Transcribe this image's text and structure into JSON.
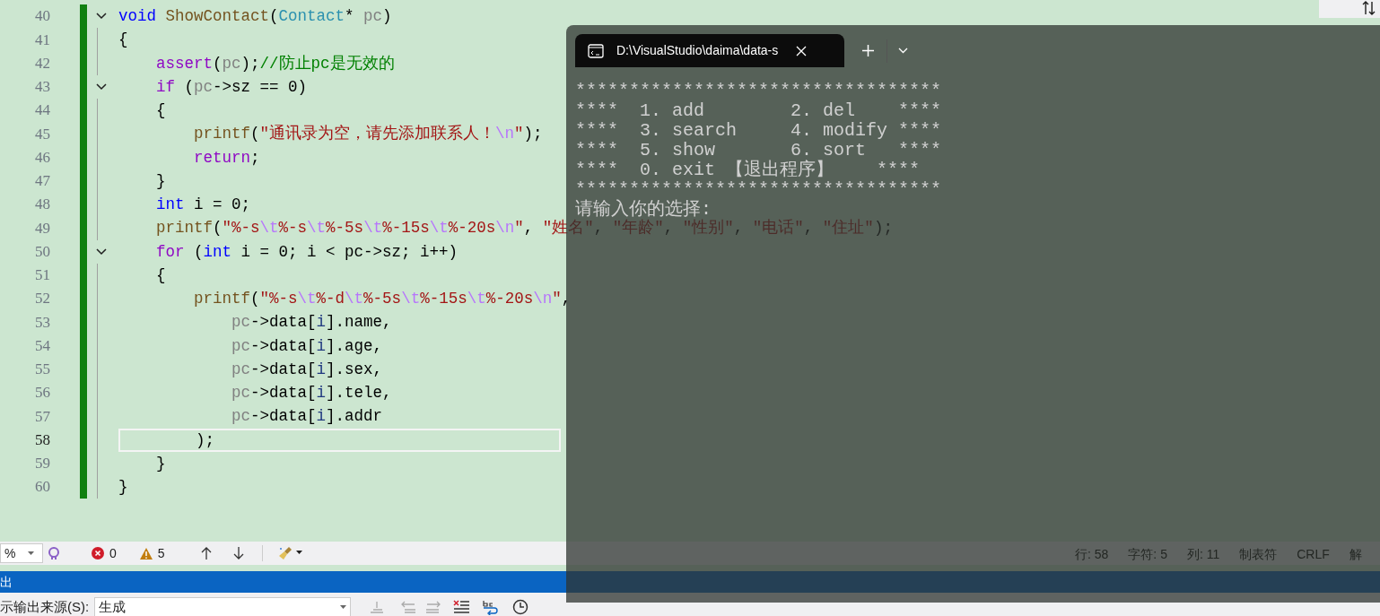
{
  "editor": {
    "lines": [
      {
        "number": "40",
        "foldable": true,
        "current": false,
        "tokens": [
          {
            "kind": "keyword",
            "text": "void "
          },
          {
            "kind": "function",
            "text": "ShowContact"
          },
          {
            "kind": "plain",
            "text": "("
          },
          {
            "kind": "type",
            "text": "Contact"
          },
          {
            "kind": "plain",
            "text": "* "
          },
          {
            "kind": "param",
            "text": "pc"
          },
          {
            "kind": "plain",
            "text": ")"
          }
        ]
      },
      {
        "number": "41",
        "foldable": false,
        "current": false,
        "tokens": [
          {
            "kind": "plain",
            "text": "{"
          }
        ]
      },
      {
        "number": "42",
        "foldable": false,
        "current": false,
        "tokens": [
          {
            "kind": "control",
            "text": "    assert"
          },
          {
            "kind": "plain",
            "text": "("
          },
          {
            "kind": "param",
            "text": "pc"
          },
          {
            "kind": "plain",
            "text": ");"
          },
          {
            "kind": "comment",
            "text": "//防止pc是无效的"
          }
        ]
      },
      {
        "number": "43",
        "foldable": true,
        "current": false,
        "tokens": [
          {
            "kind": "control",
            "text": "    if"
          },
          {
            "kind": "plain",
            "text": " ("
          },
          {
            "kind": "param",
            "text": "pc"
          },
          {
            "kind": "plain",
            "text": "->sz == 0)"
          }
        ]
      },
      {
        "number": "44",
        "foldable": false,
        "current": false,
        "tokens": [
          {
            "kind": "plain",
            "text": "    {"
          }
        ]
      },
      {
        "number": "45",
        "foldable": false,
        "current": false,
        "tokens": [
          {
            "kind": "function",
            "text": "        printf"
          },
          {
            "kind": "plain",
            "text": "("
          },
          {
            "kind": "string",
            "text": "\"通讯录为空，请先添加联系人！"
          },
          {
            "kind": "escape",
            "text": "\\n"
          },
          {
            "kind": "string",
            "text": "\""
          },
          {
            "kind": "plain",
            "text": ");"
          }
        ]
      },
      {
        "number": "46",
        "foldable": false,
        "current": false,
        "tokens": [
          {
            "kind": "control",
            "text": "        return"
          },
          {
            "kind": "plain",
            "text": ";"
          }
        ]
      },
      {
        "number": "47",
        "foldable": false,
        "current": false,
        "tokens": [
          {
            "kind": "plain",
            "text": "    }"
          }
        ]
      },
      {
        "number": "48",
        "foldable": false,
        "current": false,
        "tokens": [
          {
            "kind": "keyword",
            "text": "    int"
          },
          {
            "kind": "plain",
            "text": " i = 0;"
          }
        ]
      },
      {
        "number": "49",
        "foldable": false,
        "current": false,
        "tokens": [
          {
            "kind": "function",
            "text": "    printf"
          },
          {
            "kind": "plain",
            "text": "("
          },
          {
            "kind": "string",
            "text": "\"%-s"
          },
          {
            "kind": "escape",
            "text": "\\t"
          },
          {
            "kind": "string",
            "text": "%-s"
          },
          {
            "kind": "escape",
            "text": "\\t"
          },
          {
            "kind": "string",
            "text": "%-5s"
          },
          {
            "kind": "escape",
            "text": "\\t"
          },
          {
            "kind": "string",
            "text": "%-15s"
          },
          {
            "kind": "escape",
            "text": "\\t"
          },
          {
            "kind": "string",
            "text": "%-20s"
          },
          {
            "kind": "escape",
            "text": "\\n"
          },
          {
            "kind": "string",
            "text": "\""
          },
          {
            "kind": "plain",
            "text": ", "
          },
          {
            "kind": "string",
            "text": "\"姓名\""
          },
          {
            "kind": "plain",
            "text": ", "
          },
          {
            "kind": "string",
            "text": "\"年龄\""
          },
          {
            "kind": "plain",
            "text": ", "
          },
          {
            "kind": "string",
            "text": "\"性别\""
          },
          {
            "kind": "plain",
            "text": ", "
          },
          {
            "kind": "string",
            "text": "\"电话\""
          },
          {
            "kind": "plain",
            "text": ", "
          },
          {
            "kind": "string",
            "text": "\"住址\""
          },
          {
            "kind": "plain",
            "text": ");"
          }
        ]
      },
      {
        "number": "50",
        "foldable": true,
        "current": false,
        "tokens": [
          {
            "kind": "control",
            "text": "    for"
          },
          {
            "kind": "plain",
            "text": " ("
          },
          {
            "kind": "keyword",
            "text": "int"
          },
          {
            "kind": "plain",
            "text": " i = 0; i < pc->sz; i++)"
          }
        ]
      },
      {
        "number": "51",
        "foldable": false,
        "current": false,
        "tokens": [
          {
            "kind": "plain",
            "text": "    {"
          }
        ]
      },
      {
        "number": "52",
        "foldable": false,
        "current": false,
        "tokens": [
          {
            "kind": "function",
            "text": "        printf"
          },
          {
            "kind": "plain",
            "text": "("
          },
          {
            "kind": "string",
            "text": "\"%-s"
          },
          {
            "kind": "escape",
            "text": "\\t"
          },
          {
            "kind": "string",
            "text": "%-d"
          },
          {
            "kind": "escape",
            "text": "\\t"
          },
          {
            "kind": "string",
            "text": "%-5s"
          },
          {
            "kind": "escape",
            "text": "\\t"
          },
          {
            "kind": "string",
            "text": "%-15s"
          },
          {
            "kind": "escape",
            "text": "\\t"
          },
          {
            "kind": "string",
            "text": "%-20s"
          },
          {
            "kind": "escape",
            "text": "\\n"
          },
          {
            "kind": "string",
            "text": "\""
          },
          {
            "kind": "plain",
            "text": ","
          }
        ]
      },
      {
        "number": "53",
        "foldable": false,
        "current": false,
        "tokens": [
          {
            "kind": "param",
            "text": "            pc"
          },
          {
            "kind": "plain",
            "text": "->data["
          },
          {
            "kind": "local",
            "text": "i"
          },
          {
            "kind": "plain",
            "text": "].name,"
          }
        ]
      },
      {
        "number": "54",
        "foldable": false,
        "current": false,
        "tokens": [
          {
            "kind": "param",
            "text": "            pc"
          },
          {
            "kind": "plain",
            "text": "->data["
          },
          {
            "kind": "local",
            "text": "i"
          },
          {
            "kind": "plain",
            "text": "].age,"
          }
        ]
      },
      {
        "number": "55",
        "foldable": false,
        "current": false,
        "tokens": [
          {
            "kind": "param",
            "text": "            pc"
          },
          {
            "kind": "plain",
            "text": "->data["
          },
          {
            "kind": "local",
            "text": "i"
          },
          {
            "kind": "plain",
            "text": "].sex,"
          }
        ]
      },
      {
        "number": "56",
        "foldable": false,
        "current": false,
        "tokens": [
          {
            "kind": "param",
            "text": "            pc"
          },
          {
            "kind": "plain",
            "text": "->data["
          },
          {
            "kind": "local",
            "text": "i"
          },
          {
            "kind": "plain",
            "text": "].tele,"
          }
        ]
      },
      {
        "number": "57",
        "foldable": false,
        "current": false,
        "tokens": [
          {
            "kind": "param",
            "text": "            pc"
          },
          {
            "kind": "plain",
            "text": "->data["
          },
          {
            "kind": "local",
            "text": "i"
          },
          {
            "kind": "plain",
            "text": "].addr"
          }
        ]
      },
      {
        "number": "58",
        "foldable": false,
        "current": true,
        "tokens": [
          {
            "kind": "plain",
            "text": "        );"
          }
        ]
      },
      {
        "number": "59",
        "foldable": false,
        "current": false,
        "tokens": [
          {
            "kind": "plain",
            "text": "    }"
          }
        ]
      },
      {
        "number": "60",
        "foldable": false,
        "current": false,
        "tokens": [
          {
            "kind": "plain",
            "text": "}"
          }
        ]
      }
    ]
  },
  "toolbar": {
    "zoom": "%",
    "errors": "0",
    "warnings": "5"
  },
  "status_bar": [
    "行: 58",
    "字符: 5",
    "列: 11",
    "制表符",
    "CRLF",
    "解"
  ],
  "output_panel": {
    "title": "出",
    "source_label": "示输出来源(S):",
    "source_value": "生成"
  },
  "terminal": {
    "tab_title": "D:\\VisualStudio\\daima\\data-s",
    "lines": [
      "**********************************",
      "****  1. add        2. del    ****",
      "****  3. search     4. modify ****",
      "****  5. show       6. sort   ****",
      "****  0. exit 【退出程序】    ****",
      "**********************************",
      "请输入你的选择:"
    ]
  }
}
